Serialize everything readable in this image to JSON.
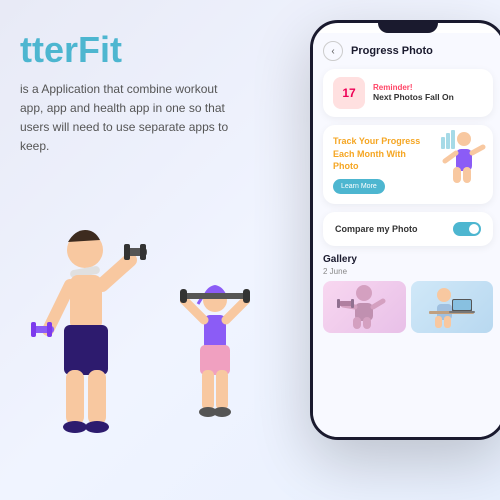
{
  "brand": {
    "name": "BetterFit",
    "name_partial": "tterFit",
    "description": "is a Application that combine workout app, app and health app in one so that users will need to use separate apps to keep."
  },
  "phone": {
    "header": {
      "back_label": "‹",
      "title": "Progress Photo"
    },
    "reminder": {
      "label": "Reminder!",
      "day": "17",
      "text": "Next Photos Fall On"
    },
    "track": {
      "text_before": "Track Your Progress Each Month With ",
      "highlight": "Photo",
      "button_label": "Learn More"
    },
    "compare": {
      "text": "Compare my Photo",
      "toggle_on": true
    },
    "gallery": {
      "title": "Gallery",
      "date": "2 June",
      "items": [
        {
          "id": 1,
          "color1": "#f8d7f0",
          "color2": "#e8c0e8"
        },
        {
          "id": 2,
          "color1": "#d0e8f8",
          "color2": "#b8d8f0"
        }
      ]
    }
  },
  "colors": {
    "accent": "#4db6d0",
    "reminder_red": "#ff4466",
    "highlight_orange": "#f5a623",
    "dark": "#1a1a2e"
  }
}
